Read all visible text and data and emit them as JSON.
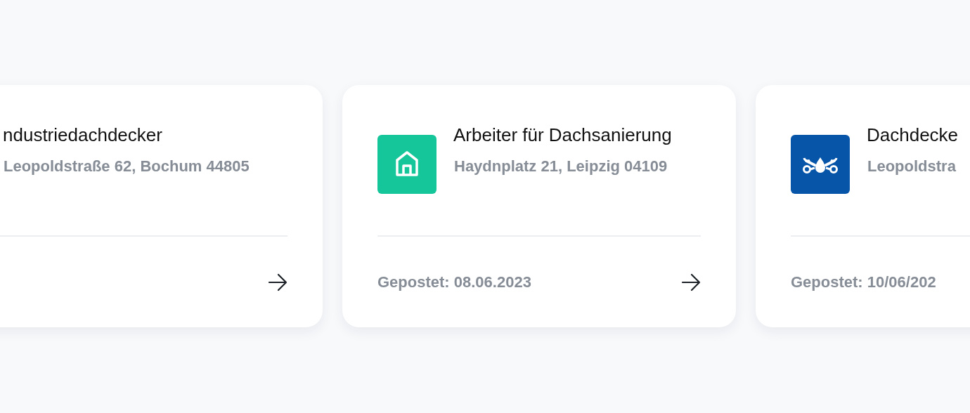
{
  "cards": [
    {
      "title": "ndustriedachdecker",
      "address": "Leopoldstraße 62, Bochum 44805",
      "arrow": true
    },
    {
      "kind": "house",
      "color": "#14c69a",
      "title": "Arbeiter für Dachsanierung",
      "address": "Haydnplatz 21, Leipzig 04109",
      "posted": "Gepostet: 08.06.2023",
      "arrow": true
    },
    {
      "kind": "wrenches",
      "color": "#0655a8",
      "title": "Dachdecke",
      "address": "Leopoldstra",
      "posted": "Gepostet: 10/06/202",
      "arrow": false
    }
  ]
}
